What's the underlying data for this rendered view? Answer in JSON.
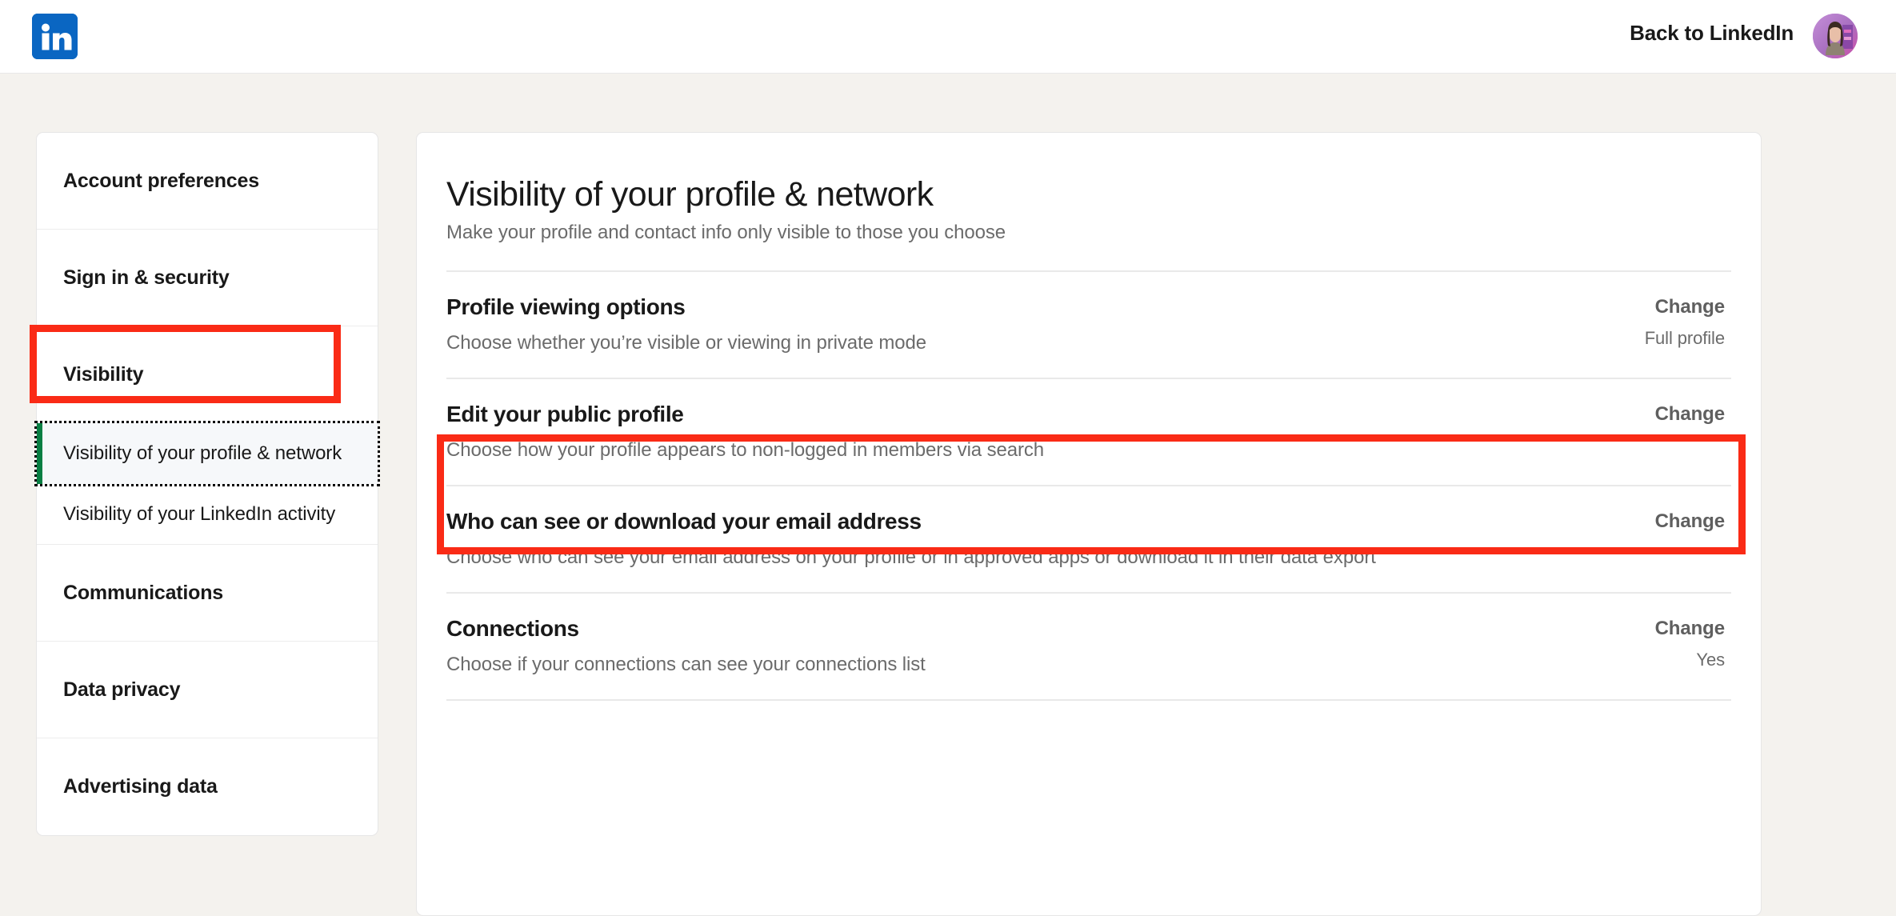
{
  "header": {
    "logo_icon": "linkedin-logo-icon",
    "back_label": "Back to LinkedIn",
    "avatar_icon": "user-avatar",
    "brand_color": "#0a66c2"
  },
  "sidebar": {
    "items": [
      {
        "label": "Account preferences"
      },
      {
        "label": "Sign in & security"
      },
      {
        "label": "Visibility",
        "highlighted": true
      },
      {
        "label": "Communications"
      },
      {
        "label": "Data privacy"
      },
      {
        "label": "Advertising data"
      }
    ],
    "sub_items": [
      {
        "label": "Visibility of your profile & network",
        "active": true
      },
      {
        "label": "Visibility of your LinkedIn activity",
        "active": false
      }
    ],
    "active_indicator_color": "#087f43"
  },
  "main": {
    "title": "Visibility of your profile & network",
    "subtitle": "Make your profile and contact info only visible to those you choose",
    "rows": [
      {
        "title": "Profile viewing options",
        "desc": "Choose whether you’re visible or viewing in private mode",
        "action": "Change",
        "value": "Full profile"
      },
      {
        "title": "Edit your public profile",
        "desc": "Choose how your profile appears to non-logged in members via search",
        "action": "Change",
        "value": "",
        "highlighted": true
      },
      {
        "title": "Who can see or download your email address",
        "desc": "Choose who can see your email address on your profile or in approved apps or download it in their data export",
        "action": "Change",
        "value": ""
      },
      {
        "title": "Connections",
        "desc": "Choose if your connections can see your connections list",
        "action": "Change",
        "value": "Yes"
      }
    ]
  },
  "annotations": {
    "color": "#fa2b16",
    "targets": [
      "Visibility",
      "Edit your public profile"
    ]
  }
}
